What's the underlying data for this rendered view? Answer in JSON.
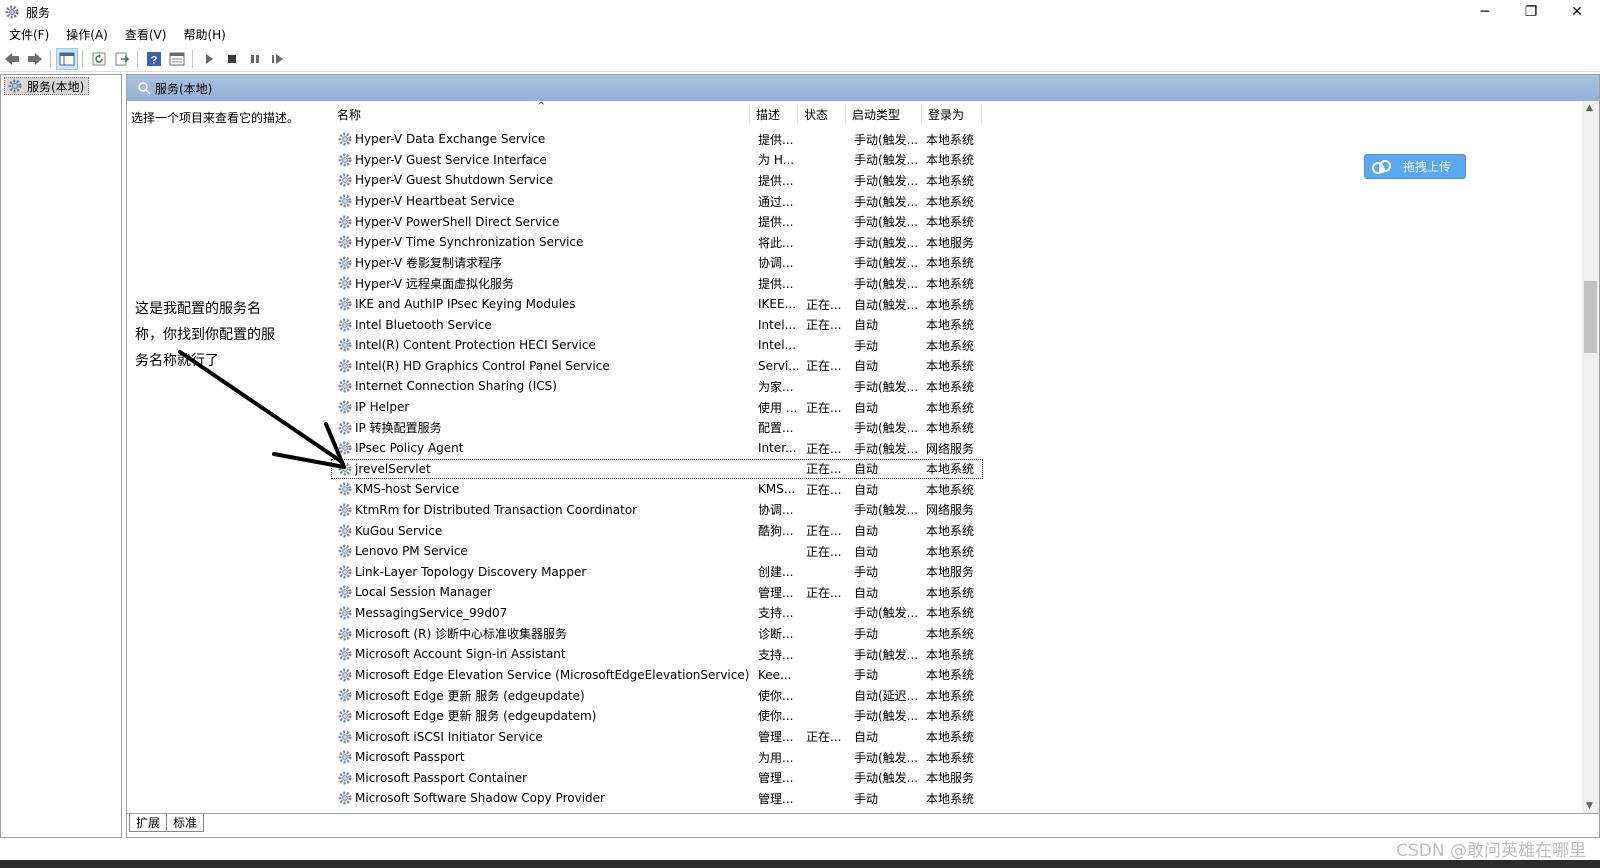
{
  "window": {
    "title": "服务",
    "minimize": "─",
    "maximize": "❐",
    "close": "✕"
  },
  "menu": [
    "文件(F)",
    "操作(A)",
    "查看(V)",
    "帮助(H)"
  ],
  "tree": {
    "root_label": "服务(本地)"
  },
  "pane": {
    "header": "服务(本地)",
    "hint": "选择一个项目来查看它的描述。",
    "annotation": "这是我配置的服务名称，你找到你配置的服务名称就行了"
  },
  "columns": {
    "name": "名称",
    "desc": "描述",
    "status": "状态",
    "start": "启动类型",
    "logon": "登录为"
  },
  "services": [
    {
      "name": "Hyper-V Data Exchange Service",
      "desc": "提供...",
      "status": "",
      "start": "手动(触发...",
      "logon": "本地系统"
    },
    {
      "name": "Hyper-V Guest Service Interface",
      "desc": "为 H...",
      "status": "",
      "start": "手动(触发...",
      "logon": "本地系统"
    },
    {
      "name": "Hyper-V Guest Shutdown Service",
      "desc": "提供...",
      "status": "",
      "start": "手动(触发...",
      "logon": "本地系统"
    },
    {
      "name": "Hyper-V Heartbeat Service",
      "desc": "通过...",
      "status": "",
      "start": "手动(触发...",
      "logon": "本地系统"
    },
    {
      "name": "Hyper-V PowerShell Direct Service",
      "desc": "提供...",
      "status": "",
      "start": "手动(触发...",
      "logon": "本地系统"
    },
    {
      "name": "Hyper-V Time Synchronization Service",
      "desc": "将此...",
      "status": "",
      "start": "手动(触发...",
      "logon": "本地服务"
    },
    {
      "name": "Hyper-V 卷影复制请求程序",
      "desc": "协调...",
      "status": "",
      "start": "手动(触发...",
      "logon": "本地系统"
    },
    {
      "name": "Hyper-V 远程桌面虚拟化服务",
      "desc": "提供...",
      "status": "",
      "start": "手动(触发...",
      "logon": "本地系统"
    },
    {
      "name": "IKE and AuthIP IPsec Keying Modules",
      "desc": "IKEE...",
      "status": "正在...",
      "start": "自动(触发...",
      "logon": "本地系统"
    },
    {
      "name": "Intel Bluetooth Service",
      "desc": "Intel...",
      "status": "正在...",
      "start": "自动",
      "logon": "本地系统"
    },
    {
      "name": "Intel(R) Content Protection HECI Service",
      "desc": "Intel...",
      "status": "",
      "start": "手动",
      "logon": "本地系统"
    },
    {
      "name": "Intel(R) HD Graphics Control Panel Service",
      "desc": "Servi...",
      "status": "正在...",
      "start": "自动",
      "logon": "本地系统"
    },
    {
      "name": "Internet Connection Sharing (ICS)",
      "desc": "为家...",
      "status": "",
      "start": "手动(触发...",
      "logon": "本地系统"
    },
    {
      "name": "IP Helper",
      "desc": "使用 ...",
      "status": "正在...",
      "start": "自动",
      "logon": "本地系统"
    },
    {
      "name": "IP 转换配置服务",
      "desc": "配置...",
      "status": "",
      "start": "手动(触发...",
      "logon": "本地系统"
    },
    {
      "name": "IPsec Policy Agent",
      "desc": "Inter...",
      "status": "正在...",
      "start": "手动(触发...",
      "logon": "网络服务"
    },
    {
      "name": "jrevelServlet",
      "desc": "",
      "status": "正在...",
      "start": "自动",
      "logon": "本地系统",
      "selected": true
    },
    {
      "name": "KMS-host Service",
      "desc": "KMS...",
      "status": "正在...",
      "start": "自动",
      "logon": "本地系统"
    },
    {
      "name": "KtmRm for Distributed Transaction Coordinator",
      "desc": "协调...",
      "status": "",
      "start": "手动(触发...",
      "logon": "网络服务"
    },
    {
      "name": "KuGou Service",
      "desc": "酷狗...",
      "status": "正在...",
      "start": "自动",
      "logon": "本地系统"
    },
    {
      "name": "Lenovo PM Service",
      "desc": "",
      "status": "正在...",
      "start": "自动",
      "logon": "本地系统"
    },
    {
      "name": "Link-Layer Topology Discovery Mapper",
      "desc": "创建...",
      "status": "",
      "start": "手动",
      "logon": "本地服务"
    },
    {
      "name": "Local Session Manager",
      "desc": "管理...",
      "status": "正在...",
      "start": "自动",
      "logon": "本地系统"
    },
    {
      "name": "MessagingService_99d07",
      "desc": "支持...",
      "status": "",
      "start": "手动(触发...",
      "logon": "本地系统"
    },
    {
      "name": "Microsoft (R) 诊断中心标准收集器服务",
      "desc": "诊断...",
      "status": "",
      "start": "手动",
      "logon": "本地系统"
    },
    {
      "name": "Microsoft Account Sign-in Assistant",
      "desc": "支持...",
      "status": "",
      "start": "手动(触发...",
      "logon": "本地系统"
    },
    {
      "name": "Microsoft Edge Elevation Service (MicrosoftEdgeElevationService)",
      "desc": "Kee...",
      "status": "",
      "start": "手动",
      "logon": "本地系统"
    },
    {
      "name": "Microsoft Edge 更新 服务 (edgeupdate)",
      "desc": "使你...",
      "status": "",
      "start": "自动(延迟...",
      "logon": "本地系统"
    },
    {
      "name": "Microsoft Edge 更新 服务 (edgeupdatem)",
      "desc": "使你...",
      "status": "",
      "start": "手动(触发...",
      "logon": "本地系统"
    },
    {
      "name": "Microsoft iSCSI Initiator Service",
      "desc": "管理...",
      "status": "正在...",
      "start": "自动",
      "logon": "本地系统"
    },
    {
      "name": "Microsoft Passport",
      "desc": "为用...",
      "status": "",
      "start": "手动(触发...",
      "logon": "本地系统"
    },
    {
      "name": "Microsoft Passport Container",
      "desc": "管理...",
      "status": "",
      "start": "手动(触发...",
      "logon": "本地服务"
    },
    {
      "name": "Microsoft Software Shadow Copy Provider",
      "desc": "管理...",
      "status": "",
      "start": "手动",
      "logon": "本地系统"
    }
  ],
  "upload": {
    "label": "拖拽上传"
  },
  "tabs": [
    "扩展",
    "标准"
  ],
  "watermark": "CSDN @敢问英雄在哪里"
}
